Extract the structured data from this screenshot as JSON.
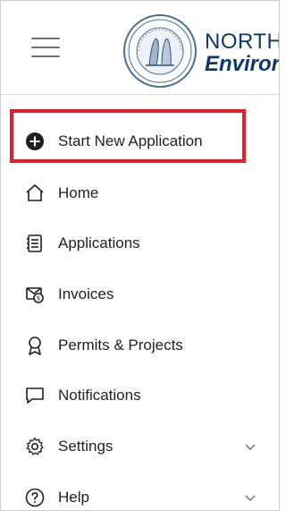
{
  "header": {
    "brand_line1": "NORTH",
    "brand_line2": "Enviror",
    "seal_icon": "nc-state-seal-icon",
    "menu_icon": "hamburger-menu-icon"
  },
  "nav": {
    "items": [
      {
        "label": "Start New Application",
        "icon": "plus-circle-icon",
        "highlighted": true
      },
      {
        "label": "Home",
        "icon": "home-icon"
      },
      {
        "label": "Applications",
        "icon": "document-list-icon"
      },
      {
        "label": "Invoices",
        "icon": "invoice-icon"
      },
      {
        "label": "Permits & Projects",
        "icon": "award-ribbon-icon"
      },
      {
        "label": "Notifications",
        "icon": "message-icon"
      },
      {
        "label": "Settings",
        "icon": "gear-icon",
        "expandable": true
      },
      {
        "label": "Help",
        "icon": "help-circle-icon",
        "expandable": true
      }
    ]
  },
  "colors": {
    "highlight": "#e21f2a",
    "brand": "#0f3a66"
  }
}
